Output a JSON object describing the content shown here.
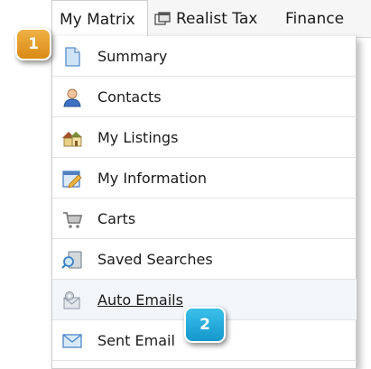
{
  "nav": {
    "tabs": [
      {
        "label": "My Matrix",
        "icon": "none"
      },
      {
        "label": "Realist Tax",
        "icon": "windows-icon"
      },
      {
        "label": "Finance",
        "icon": "none"
      }
    ]
  },
  "menu": {
    "items": [
      {
        "label": "Summary",
        "icon": "document-icon"
      },
      {
        "label": "Contacts",
        "icon": "person-icon"
      },
      {
        "label": "My Listings",
        "icon": "houses-icon"
      },
      {
        "label": "My Information",
        "icon": "edit-form-icon"
      },
      {
        "label": "Carts",
        "icon": "cart-icon"
      },
      {
        "label": "Saved Searches",
        "icon": "saved-search-icon"
      },
      {
        "label": "Auto Emails",
        "icon": "auto-email-icon"
      },
      {
        "label": "Sent Email",
        "icon": "envelope-icon"
      }
    ]
  },
  "callouts": {
    "first": "1",
    "second": "2"
  },
  "colors": {
    "badge_orange": "#e39a22",
    "badge_blue": "#23aedd",
    "menu_divider": "#e3e3e3",
    "nav_background": "#f6f6f6"
  }
}
